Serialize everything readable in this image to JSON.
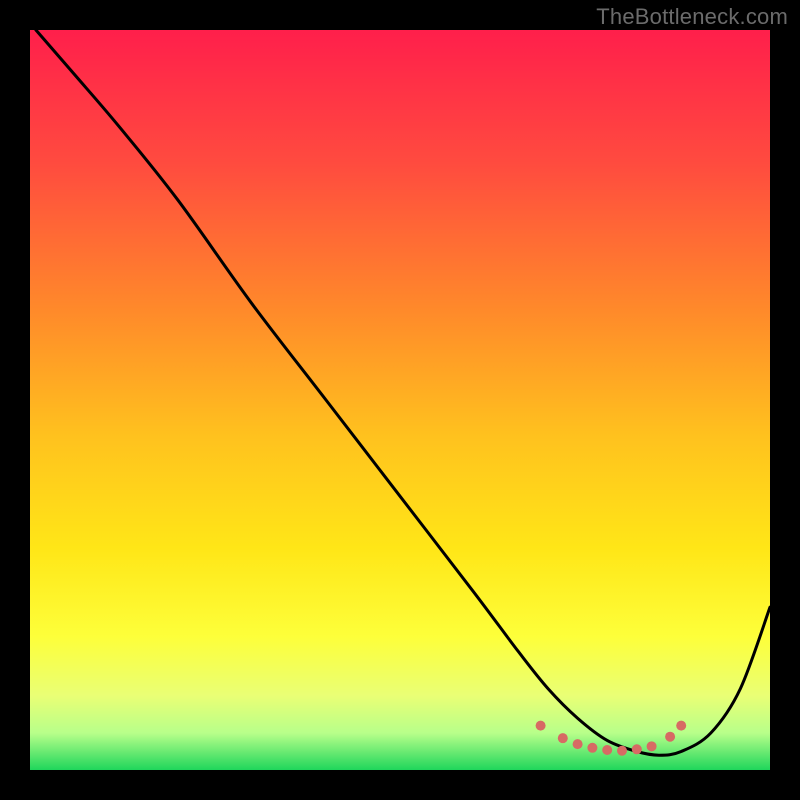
{
  "watermark": "TheBottleneck.com",
  "chart_data": {
    "type": "line",
    "title": "",
    "xlabel": "",
    "ylabel": "",
    "xlim": [
      0,
      100
    ],
    "ylim": [
      0,
      100
    ],
    "gradient_stops": [
      {
        "offset": 0,
        "color": "#ff1f4b"
      },
      {
        "offset": 18,
        "color": "#ff4b3f"
      },
      {
        "offset": 38,
        "color": "#ff8a2a"
      },
      {
        "offset": 55,
        "color": "#ffc21e"
      },
      {
        "offset": 70,
        "color": "#ffe617"
      },
      {
        "offset": 82,
        "color": "#fdff3a"
      },
      {
        "offset": 90,
        "color": "#e9ff75"
      },
      {
        "offset": 95,
        "color": "#b8ff8a"
      },
      {
        "offset": 100,
        "color": "#1fd65b"
      }
    ],
    "series": [
      {
        "name": "bottleneck-curve",
        "x": [
          0.8,
          6,
          12,
          20,
          30,
          40,
          50,
          60,
          66,
          70,
          74,
          78,
          82,
          85,
          88,
          92,
          96,
          100
        ],
        "y": [
          100,
          94,
          87,
          77,
          63,
          50,
          37,
          24,
          16,
          11,
          7,
          4,
          2.5,
          2,
          2.5,
          5,
          11,
          22
        ]
      }
    ],
    "flat_markers": {
      "color": "#d76a64",
      "radius": 5,
      "points": [
        {
          "x": 69,
          "y": 6.0
        },
        {
          "x": 72,
          "y": 4.3
        },
        {
          "x": 74,
          "y": 3.5
        },
        {
          "x": 76,
          "y": 3.0
        },
        {
          "x": 78,
          "y": 2.7
        },
        {
          "x": 80,
          "y": 2.6
        },
        {
          "x": 82,
          "y": 2.8
        },
        {
          "x": 84,
          "y": 3.2
        },
        {
          "x": 86.5,
          "y": 4.5
        },
        {
          "x": 88,
          "y": 6.0
        }
      ]
    }
  }
}
